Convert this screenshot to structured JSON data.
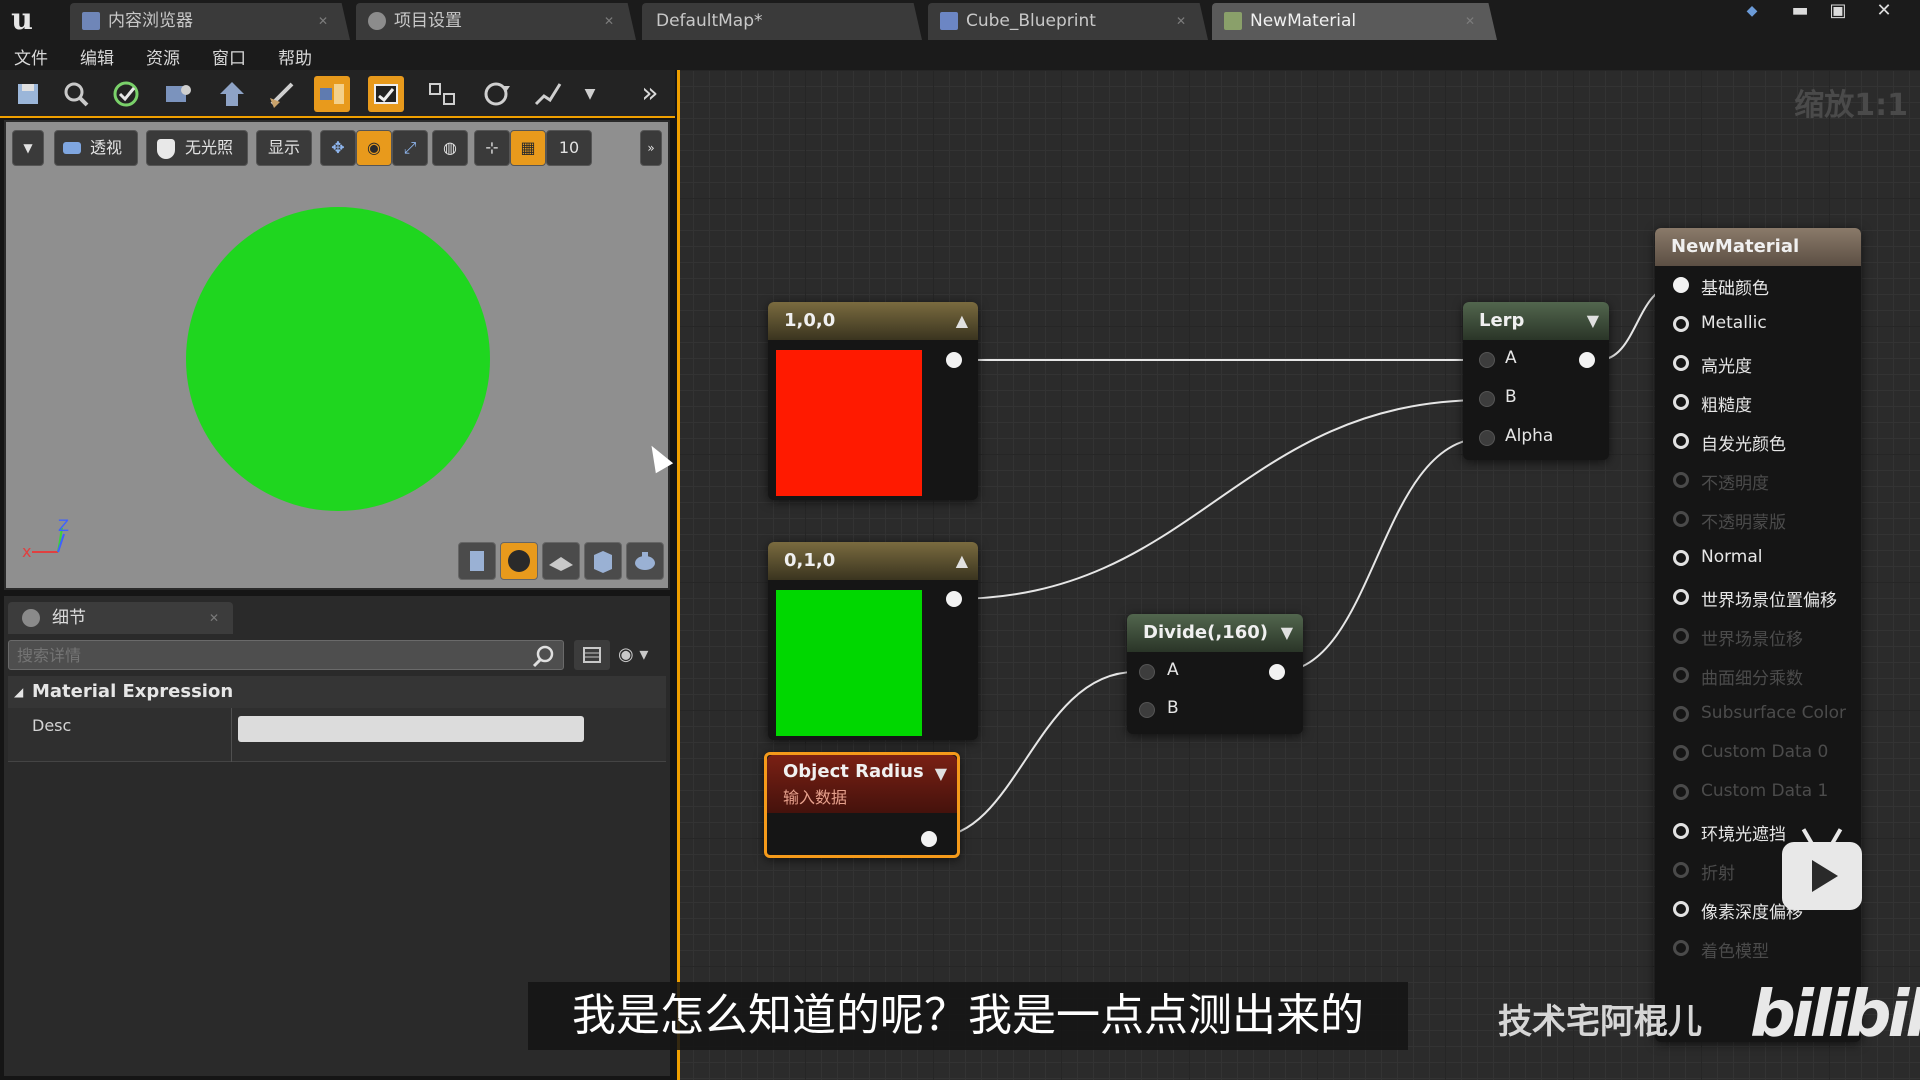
{
  "titlebar": {
    "tabs": [
      {
        "label": "内容浏览器",
        "icon": "content-browser-icon"
      },
      {
        "label": "项目设置",
        "icon": "gear-icon"
      },
      {
        "label": "DefaultMap*"
      },
      {
        "label": "Cube_Blueprint",
        "icon": "blueprint-icon"
      },
      {
        "label": "NewMaterial",
        "icon": "material-icon"
      }
    ]
  },
  "menu": {
    "items": [
      "文件",
      "编辑",
      "资源",
      "窗口",
      "帮助"
    ]
  },
  "viewport": {
    "buttons": {
      "perspective": "透视",
      "unlit": "无光照",
      "show": "显示",
      "grid_snap": "10"
    },
    "preview_color": "#1fd61f",
    "axis_z": "Z",
    "axis_x": "x"
  },
  "details": {
    "tab": "细节",
    "search_placeholder": "搜索详情",
    "section": "Material Expression",
    "desc_label": "Desc"
  },
  "graph": {
    "zoom": "缩放1:1",
    "nodes": {
      "red": {
        "title": "1,0,0",
        "color": "#ff1a00"
      },
      "green": {
        "title": "0,1,0",
        "color": "#00d700"
      },
      "radius": {
        "title": "Object Radius",
        "subtitle": "输入数据"
      },
      "divide": {
        "title": "Divide(,160)",
        "pin_a": "A",
        "pin_b": "B"
      },
      "lerp": {
        "title": "Lerp",
        "pin_a": "A",
        "pin_b": "B",
        "pin_alpha": "Alpha"
      },
      "material": {
        "title": "NewMaterial",
        "inputs": [
          {
            "label": "基础颜色",
            "state": "connected"
          },
          {
            "label": "Metallic",
            "state": "active"
          },
          {
            "label": "高光度",
            "state": "active"
          },
          {
            "label": "粗糙度",
            "state": "active"
          },
          {
            "label": "自发光颜色",
            "state": "active"
          },
          {
            "label": "不透明度",
            "state": "disabled"
          },
          {
            "label": "不透明蒙版",
            "state": "disabled"
          },
          {
            "label": "Normal",
            "state": "active"
          },
          {
            "label": "世界场景位置偏移",
            "state": "active"
          },
          {
            "label": "世界场景位移",
            "state": "disabled"
          },
          {
            "label": "曲面细分乘数",
            "state": "disabled"
          },
          {
            "label": "Subsurface Color",
            "state": "disabled"
          },
          {
            "label": "Custom Data 0",
            "state": "disabled"
          },
          {
            "label": "Custom Data 1",
            "state": "disabled"
          },
          {
            "label": "环境光遮挡",
            "state": "active"
          },
          {
            "label": "折射",
            "state": "disabled"
          },
          {
            "label": "像素深度偏移",
            "state": "active"
          },
          {
            "label": "着色模型",
            "state": "disabled"
          }
        ]
      }
    }
  },
  "overlay": {
    "subtitle": "我是怎么知道的呢？我是一点点测出来的",
    "watermark": "技术宅阿棍儿",
    "logo": "bilibili"
  }
}
